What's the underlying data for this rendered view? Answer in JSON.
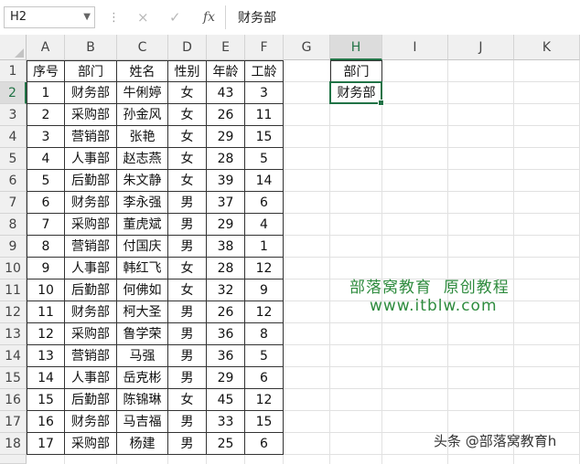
{
  "formula_bar": {
    "name_box": "H2",
    "cancel_icon": "×",
    "enter_icon": "✓",
    "fx_label": "fx",
    "content": "财务部"
  },
  "columns": [
    "A",
    "B",
    "C",
    "D",
    "E",
    "F",
    "G",
    "H",
    "I",
    "J",
    "K"
  ],
  "selected_column": "H",
  "selected_row": 2,
  "rows": [
    1,
    2,
    3,
    4,
    5,
    6,
    7,
    8,
    9,
    10,
    11,
    12,
    13,
    14,
    15,
    16,
    17,
    18
  ],
  "table": {
    "headers": [
      "序号",
      "部门",
      "姓名",
      "性别",
      "年龄",
      "工龄"
    ],
    "records": [
      [
        "1",
        "财务部",
        "牛俐婷",
        "女",
        "43",
        "3"
      ],
      [
        "2",
        "采购部",
        "孙金风",
        "女",
        "26",
        "11"
      ],
      [
        "3",
        "营销部",
        "张艳",
        "女",
        "29",
        "15"
      ],
      [
        "4",
        "人事部",
        "赵志燕",
        "女",
        "28",
        "5"
      ],
      [
        "5",
        "后勤部",
        "朱文静",
        "女",
        "39",
        "14"
      ],
      [
        "6",
        "财务部",
        "李永强",
        "男",
        "37",
        "6"
      ],
      [
        "7",
        "采购部",
        "董虎斌",
        "男",
        "29",
        "4"
      ],
      [
        "8",
        "营销部",
        "付国庆",
        "男",
        "38",
        "1"
      ],
      [
        "9",
        "人事部",
        "韩红飞",
        "女",
        "28",
        "12"
      ],
      [
        "10",
        "后勤部",
        "何佛如",
        "女",
        "32",
        "9"
      ],
      [
        "11",
        "财务部",
        "柯大圣",
        "男",
        "26",
        "12"
      ],
      [
        "12",
        "采购部",
        "鲁学荣",
        "男",
        "36",
        "8"
      ],
      [
        "13",
        "营销部",
        "马强",
        "男",
        "36",
        "5"
      ],
      [
        "14",
        "人事部",
        "岳克彬",
        "男",
        "29",
        "6"
      ],
      [
        "15",
        "后勤部",
        "陈锦琳",
        "女",
        "45",
        "12"
      ],
      [
        "16",
        "财务部",
        "马吉福",
        "男",
        "33",
        "15"
      ],
      [
        "17",
        "采购部",
        "杨建",
        "男",
        "25",
        "6"
      ]
    ]
  },
  "criteria": {
    "header": "部门",
    "value": "财务部"
  },
  "watermark": {
    "line1": "部落窝教育  原创教程",
    "line2": "www.itblw.com"
  },
  "credit": "头条 @部落窝教育h",
  "colors": {
    "accent": "#217346",
    "watermark": "#2e8b3e"
  }
}
